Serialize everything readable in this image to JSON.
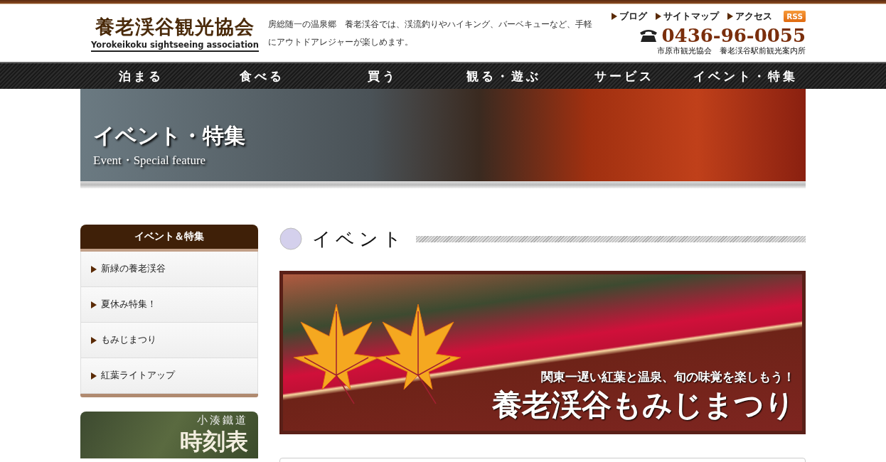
{
  "header": {
    "logo_title": "養老渓谷観光協会",
    "logo_subtitle": "Yorokeikoku sightseeing association",
    "tagline": "房総随一の温泉郷　養老渓谷では、渓流釣りやハイキング、バーベキューなど、手軽にアウトドアレジャーが楽しめます。",
    "top_links": [
      "ブログ",
      "サイトマップ",
      "アクセス"
    ],
    "rss": "RSS",
    "phone": "0436-96-0055",
    "phone_note": "市原市観光協会　養老渓谷駅前観光案内所"
  },
  "nav": [
    "泊まる",
    "食べる",
    "買う",
    "観る・遊ぶ",
    "サービス",
    "イベント・特集"
  ],
  "hero": {
    "title": "イベント・特集",
    "subtitle": "Event・Special feature"
  },
  "sidebar": {
    "title": "イベント＆特集",
    "items": [
      "新緑の養老渓谷",
      "夏休み特集！",
      "もみじまつり",
      "紅葉ライトアップ"
    ],
    "banner": {
      "line1": "小湊鐵道",
      "line2": "時刻表"
    }
  },
  "main": {
    "heading": "イベント",
    "feature": {
      "catch": "関東一遅い紅葉と温泉、旬の味覚を楽しもう！",
      "title": "養老渓谷もみじまつり"
    }
  }
}
